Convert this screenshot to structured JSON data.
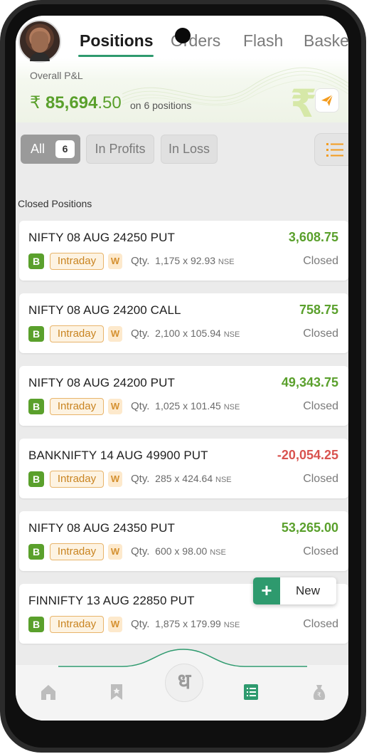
{
  "tabs": [
    {
      "label": "Positions",
      "active": true
    },
    {
      "label": "Orders",
      "active": false
    },
    {
      "label": "Flash",
      "active": false
    },
    {
      "label": "Baske",
      "active": false
    }
  ],
  "pnl": {
    "label": "Overall P&L",
    "currency": "₹",
    "value_int": "85,694",
    "value_dec": ".50",
    "sub": "on 6 positions"
  },
  "filters": {
    "all_label": "All",
    "all_count": "6",
    "profits_label": "In Profits",
    "loss_label": "In Loss"
  },
  "section_title": "Closed Positions",
  "positions": [
    {
      "name": "NIFTY 08 AUG 24250 PUT",
      "amount": "3,608.75",
      "negative": false,
      "side": "B",
      "product": "Intraday",
      "w": "W",
      "qty_label": "Qty.",
      "qty": "1,175 x 92.93",
      "exchange": "NSE",
      "status": "Closed"
    },
    {
      "name": "NIFTY 08 AUG 24200 CALL",
      "amount": "758.75",
      "negative": false,
      "side": "B",
      "product": "Intraday",
      "w": "W",
      "qty_label": "Qty.",
      "qty": "2,100 x 105.94",
      "exchange": "NSE",
      "status": "Closed"
    },
    {
      "name": "NIFTY 08 AUG 24200 PUT",
      "amount": "49,343.75",
      "negative": false,
      "side": "B",
      "product": "Intraday",
      "w": "W",
      "qty_label": "Qty.",
      "qty": "1,025 x 101.45",
      "exchange": "NSE",
      "status": "Closed"
    },
    {
      "name": "BANKNIFTY 14 AUG 49900 PUT",
      "amount": "-20,054.25",
      "negative": true,
      "side": "B",
      "product": "Intraday",
      "w": "W",
      "qty_label": "Qty.",
      "qty": "285 x 424.64",
      "exchange": "NSE",
      "status": "Closed"
    },
    {
      "name": "NIFTY 08 AUG 24350 PUT",
      "amount": "53,265.00",
      "negative": false,
      "side": "B",
      "product": "Intraday",
      "w": "W",
      "qty_label": "Qty.",
      "qty": "600 x 98.00",
      "exchange": "NSE",
      "status": "Closed"
    },
    {
      "name": "FINNIFTY 13 AUG 22850 PUT",
      "amount": "",
      "negative": true,
      "side": "B",
      "product": "Intraday",
      "w": "W",
      "qty_label": "Qty.",
      "qty": "1,875 x 179.99",
      "exchange": "NSE",
      "status": "Closed"
    }
  ],
  "fab": {
    "icon": "+",
    "label": "New"
  },
  "bottom_nav": {
    "center_glyph": "ध",
    "items": [
      {
        "icon": "home-icon",
        "active": false
      },
      {
        "icon": "bookmark-icon",
        "active": false
      },
      {
        "icon": "positions-list-icon",
        "active": true
      },
      {
        "icon": "money-bag-icon",
        "active": false
      }
    ]
  },
  "colors": {
    "accent": "#2e9a6e",
    "profit": "#5aa02c",
    "loss": "#d9534f",
    "intraday": "#c98421"
  }
}
